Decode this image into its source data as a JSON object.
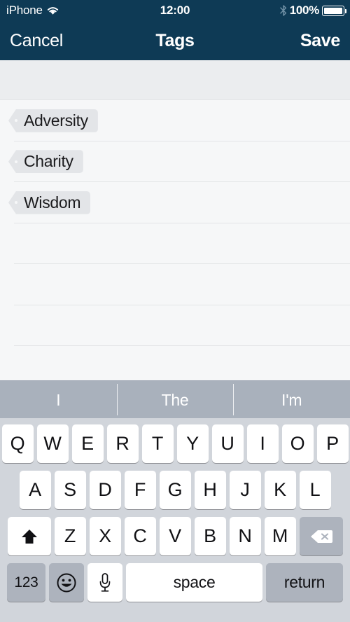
{
  "status_bar": {
    "carrier": "iPhone",
    "wifi_icon": "wifi-icon",
    "time": "12:00",
    "bluetooth_icon": "bluetooth-icon",
    "battery_percent": "100%",
    "battery_icon": "battery-full-icon",
    "background_color": "#0e3a55",
    "text_color": "#ffffff"
  },
  "nav_bar": {
    "cancel_label": "Cancel",
    "title": "Tags",
    "save_label": "Save",
    "background_color": "#0e3a55"
  },
  "tag_list": {
    "tags": [
      {
        "label": "Adversity"
      },
      {
        "label": "Charity"
      },
      {
        "label": "Wisdom"
      }
    ],
    "empty_row_count": 4,
    "tag_background_color": "#e3e5e8",
    "tag_text_color": "#1b1b1d",
    "separator_color": "#e3e5e7"
  },
  "keyboard": {
    "suggestions": [
      "I",
      "The",
      "I'm"
    ],
    "suggestion_bar_color": "#a9b1bc",
    "background_color": "#d1d5db",
    "row1": [
      "Q",
      "W",
      "E",
      "R",
      "T",
      "Y",
      "U",
      "I",
      "O",
      "P"
    ],
    "row2": [
      "A",
      "S",
      "D",
      "F",
      "G",
      "H",
      "J",
      "K",
      "L"
    ],
    "row3": [
      "Z",
      "X",
      "C",
      "V",
      "B",
      "N",
      "M"
    ],
    "shift_key": {
      "icon": "shift-up-arrow-icon",
      "state": "active"
    },
    "delete_key": {
      "icon": "backspace-delete-icon"
    },
    "numbers_key": "123",
    "emoji_key": {
      "icon": "smiley-face-icon"
    },
    "dictation_key": {
      "icon": "microphone-icon"
    },
    "space_key": "space",
    "return_key": "return"
  }
}
